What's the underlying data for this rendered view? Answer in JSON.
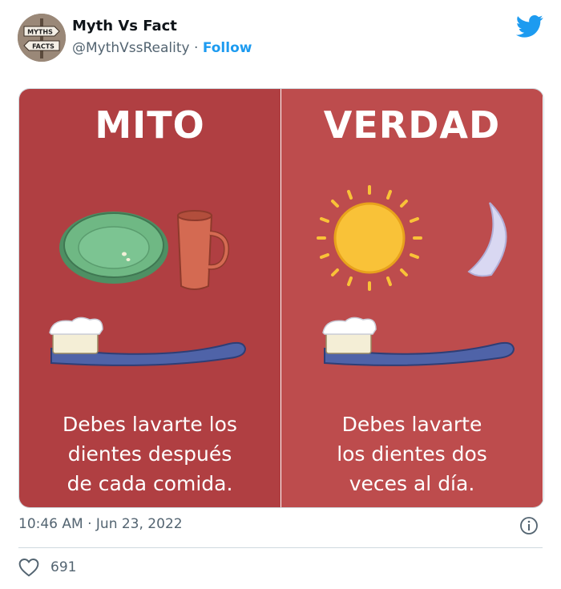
{
  "author": {
    "name": "Myth Vs Fact",
    "handle": "@MythVssReality",
    "separator": " · ",
    "follow_label": "Follow",
    "avatar_sign_top": "MYTHS",
    "avatar_sign_bottom": "FACTS"
  },
  "media": {
    "left": {
      "title": "MITO",
      "caption_lines": [
        "Debes lavarte los",
        "dientes después",
        "de cada comida."
      ]
    },
    "right": {
      "title": "VERDAD",
      "caption_lines": [
        "Debes lavarte",
        "los dientes dos",
        "veces al día."
      ]
    }
  },
  "meta": {
    "timestamp": "10:46 AM · Jun 23, 2022"
  },
  "actions": {
    "like_count": "691"
  },
  "colors": {
    "accent": "#1d9bf0",
    "panel_left": "#b03f42",
    "panel_right": "#bd4c4d"
  }
}
